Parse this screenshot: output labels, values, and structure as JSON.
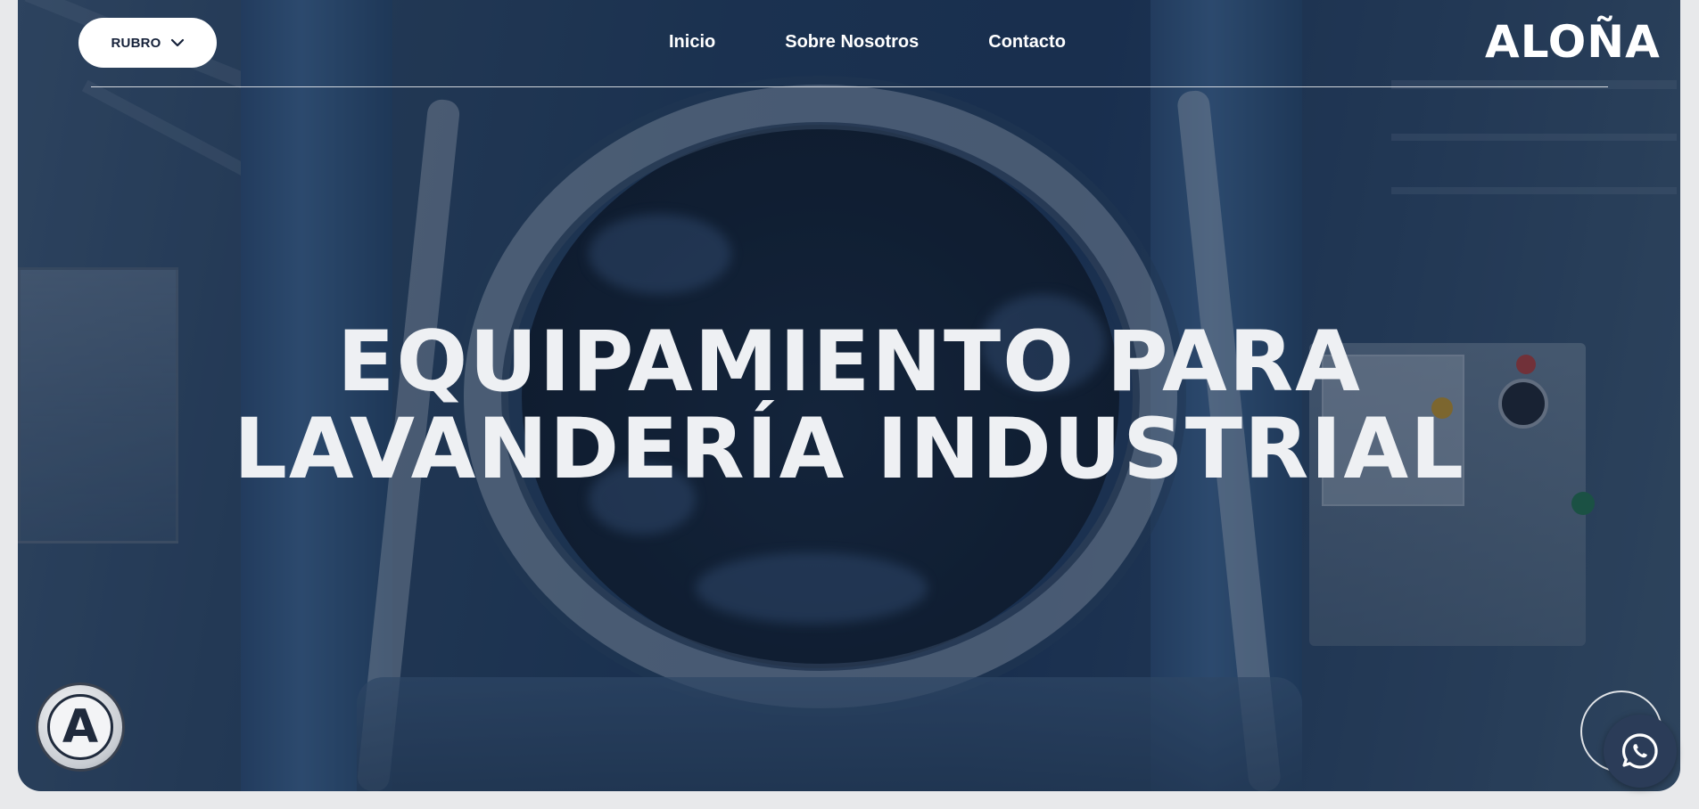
{
  "header": {
    "rubro_label": "RUBRO",
    "nav": [
      "Inicio",
      "Sobre Nosotros",
      "Contacto"
    ],
    "logo_text": "ALOÑA"
  },
  "hero": {
    "title_line1": "EQUIPAMIENTO PARA",
    "title_line2": "LAVANDERÍA INDUSTRIAL"
  },
  "badge": {
    "letter": "A"
  },
  "icons": {
    "rubro_chevron": "chevron-down-icon",
    "whatsapp": "whatsapp-icon"
  },
  "colors": {
    "overlay": "#1c365a",
    "whatsapp_bg": "#2b3c58",
    "text": "#ffffff"
  }
}
